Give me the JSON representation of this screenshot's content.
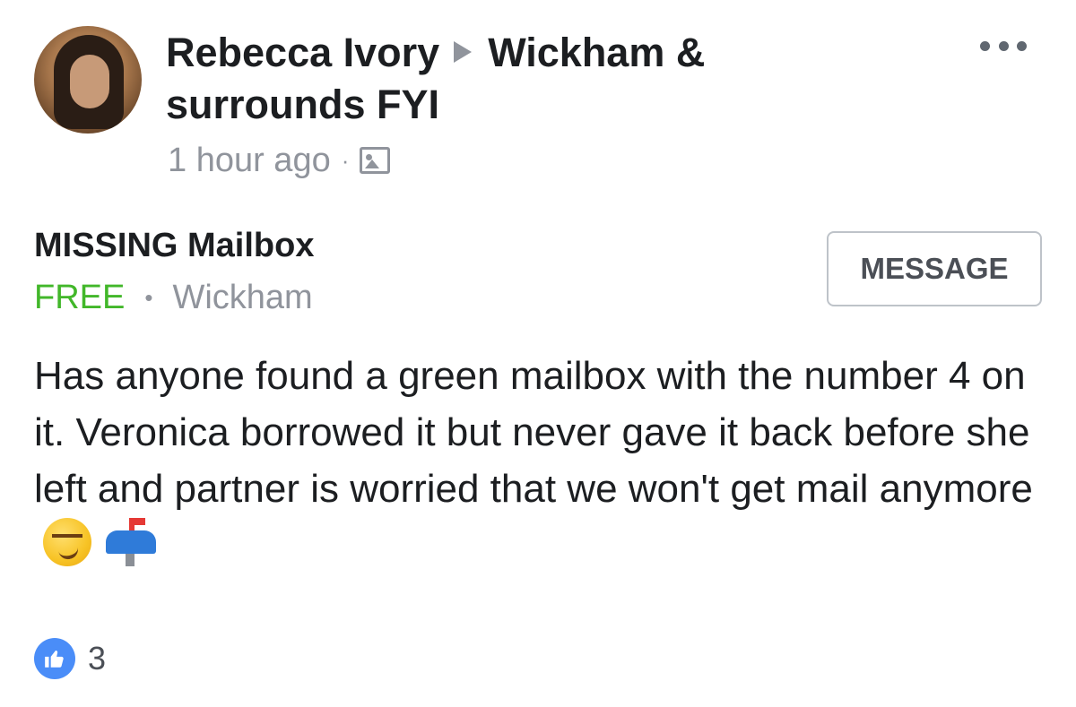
{
  "post": {
    "author": "Rebecca Ivory",
    "group": "Wickham & surrounds FYI",
    "time": "1 hour ago",
    "meta_separator": "·",
    "privacy_icon": "photo-icon",
    "more_icon": "more-dots-icon"
  },
  "listing": {
    "title": "MISSING Mailbox",
    "price": "FREE",
    "separator": "•",
    "location": "Wickham",
    "price_color": "#42b72a",
    "message_button": "MESSAGE"
  },
  "body": {
    "text": "Has anyone found a green mailbox with the number 4 on it. Veronica borrowed it but never gave it back before she left and partner is worried that we won't get mail anymore",
    "emojis": [
      "smirk-emoji",
      "mailbox-emoji"
    ]
  },
  "reactions": {
    "icon": "like-icon",
    "count": "3",
    "color": "#4a8df8"
  }
}
